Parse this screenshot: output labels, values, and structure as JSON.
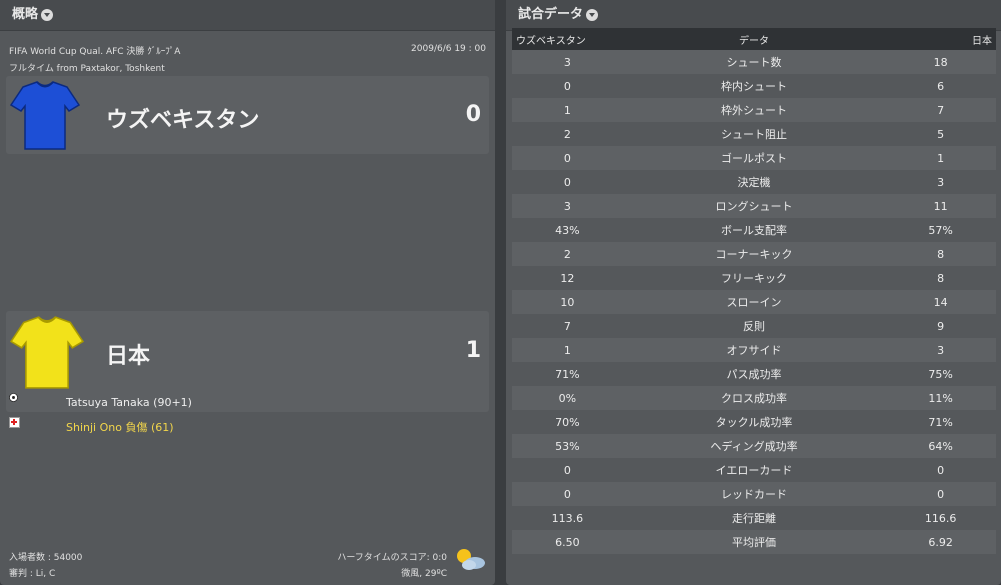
{
  "left_panel": {
    "title": "概略",
    "competition": "FIFA World Cup Qual. AFC 決勝 ｸﾞﾙｰﾌﾟA",
    "datetime": "2009/6/6 19 : 00",
    "venue": "フルタイム from Paxtakor, Toshkent",
    "home": {
      "name": "ウズベキスタン",
      "score": "0",
      "shirt_color": "#1d4fd6"
    },
    "away": {
      "name": "日本",
      "score": "1",
      "shirt_color": "#f2e21a"
    },
    "goal_event": "Tatsuya Tanaka (90+1)",
    "injury_event": "Shinji Ono 負傷 (61)",
    "attendance": "入場者数 :  54000",
    "referee": "審判 :  Li, C",
    "halftime": "ハーフタイムのスコア: 0:0",
    "weather": "微風, 29ºC"
  },
  "right_panel": {
    "title": "試合データ",
    "headers": {
      "home": "ウズベキスタン",
      "label": "データ",
      "away": "日本"
    },
    "rows": [
      {
        "home": "3",
        "label": "シュート数",
        "away": "18"
      },
      {
        "home": "0",
        "label": "枠内シュート",
        "away": "6"
      },
      {
        "home": "1",
        "label": "枠外シュート",
        "away": "7"
      },
      {
        "home": "2",
        "label": "シュート阻止",
        "away": "5"
      },
      {
        "home": "0",
        "label": "ゴールポスト",
        "away": "1"
      },
      {
        "home": "0",
        "label": "決定機",
        "away": "3"
      },
      {
        "home": "3",
        "label": "ロングシュート",
        "away": "11"
      },
      {
        "home": "43%",
        "label": "ボール支配率",
        "away": "57%"
      },
      {
        "home": "2",
        "label": "コーナーキック",
        "away": "8"
      },
      {
        "home": "12",
        "label": "フリーキック",
        "away": "8"
      },
      {
        "home": "10",
        "label": "スローイン",
        "away": "14"
      },
      {
        "home": "7",
        "label": "反則",
        "away": "9"
      },
      {
        "home": "1",
        "label": "オフサイド",
        "away": "3"
      },
      {
        "home": "71%",
        "label": "パス成功率",
        "away": "75%"
      },
      {
        "home": "0%",
        "label": "クロス成功率",
        "away": "11%"
      },
      {
        "home": "70%",
        "label": "タックル成功率",
        "away": "71%"
      },
      {
        "home": "53%",
        "label": "ヘディング成功率",
        "away": "64%"
      },
      {
        "home": "0",
        "label": "イエローカード",
        "away": "0"
      },
      {
        "home": "0",
        "label": "レッドカード",
        "away": "0"
      },
      {
        "home": "113.6",
        "label": "走行距離",
        "away": "116.6"
      },
      {
        "home": "6.50",
        "label": "平均評価",
        "away": "6.92"
      }
    ]
  },
  "icons": {
    "header_chevron": "chevron-down-icon",
    "goal": "soccer-ball-icon",
    "injury": "injury-cross-icon",
    "weather": "sun-cloud-icon"
  }
}
